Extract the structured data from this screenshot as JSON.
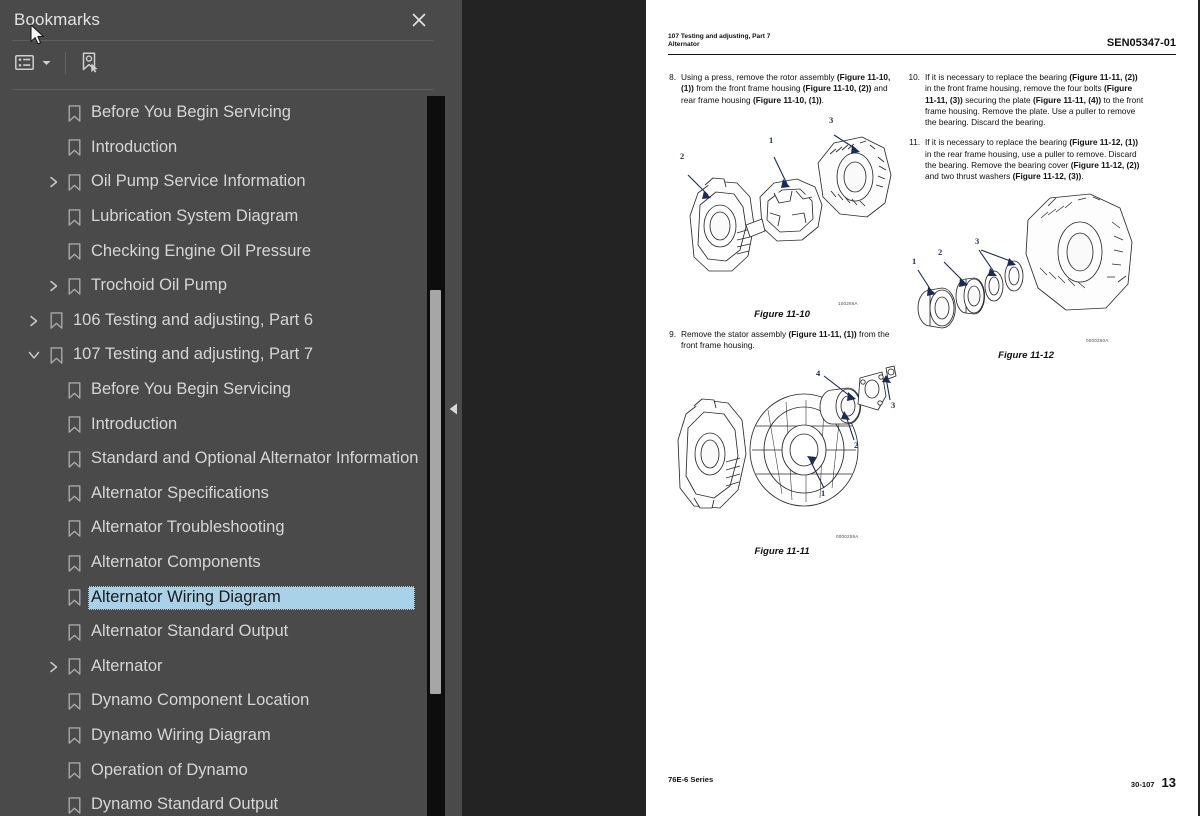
{
  "panel": {
    "title": "Bookmarks",
    "close_icon": "close-icon",
    "toolbar": {
      "options_icon": "list-options-icon",
      "options_caret_icon": "chevron-down-icon",
      "new_bookmark_icon": "new-bookmark-icon"
    }
  },
  "tree": {
    "items": [
      {
        "label": "Before You Begin Servicing",
        "depth": 2,
        "twisty": "",
        "selected": false
      },
      {
        "label": "Introduction",
        "depth": 2,
        "twisty": "",
        "selected": false
      },
      {
        "label": "Oil Pump Service Information",
        "depth": 2,
        "twisty": "collapsed",
        "selected": false
      },
      {
        "label": "Lubrication System Diagram",
        "depth": 2,
        "twisty": "",
        "selected": false
      },
      {
        "label": "Checking Engine Oil Pressure",
        "depth": 2,
        "twisty": "",
        "selected": false
      },
      {
        "label": "Trochoid Oil Pump",
        "depth": 2,
        "twisty": "collapsed",
        "selected": false
      },
      {
        "label": "106 Testing and adjusting, Part 6",
        "depth": 1,
        "twisty": "collapsed",
        "selected": false
      },
      {
        "label": "107 Testing and adjusting, Part 7",
        "depth": 1,
        "twisty": "expanded",
        "selected": false
      },
      {
        "label": "Before You Begin Servicing",
        "depth": 2,
        "twisty": "",
        "selected": false
      },
      {
        "label": "Introduction",
        "depth": 2,
        "twisty": "",
        "selected": false
      },
      {
        "label": "Standard and Optional Alternator Information",
        "depth": 2,
        "twisty": "",
        "selected": false
      },
      {
        "label": "Alternator Specifications",
        "depth": 2,
        "twisty": "",
        "selected": false
      },
      {
        "label": "Alternator Troubleshooting",
        "depth": 2,
        "twisty": "",
        "selected": false
      },
      {
        "label": "Alternator Components",
        "depth": 2,
        "twisty": "",
        "selected": false
      },
      {
        "label": "Alternator Wiring Diagram",
        "depth": 2,
        "twisty": "",
        "selected": true
      },
      {
        "label": "Alternator Standard Output",
        "depth": 2,
        "twisty": "",
        "selected": false
      },
      {
        "label": "Alternator",
        "depth": 2,
        "twisty": "collapsed",
        "selected": false
      },
      {
        "label": "Dynamo Component Location",
        "depth": 2,
        "twisty": "",
        "selected": false
      },
      {
        "label": "Dynamo Wiring Diagram",
        "depth": 2,
        "twisty": "",
        "selected": false
      },
      {
        "label": "Operation of Dynamo",
        "depth": 2,
        "twisty": "",
        "selected": false
      },
      {
        "label": "Dynamo Standard Output",
        "depth": 2,
        "twisty": "",
        "selected": false
      }
    ]
  },
  "splitter": {
    "collapse_icon": "collapse-left-icon"
  },
  "document": {
    "header": {
      "left_line1": "107 Testing and adjusting, Part 7",
      "left_line2": "Alternator",
      "right": "SEN05347-01"
    },
    "left_column": {
      "steps": [
        {
          "num": "8.",
          "runs": [
            {
              "t": "Using a press, remove the rotor assembly ",
              "b": false
            },
            {
              "t": "(Figure 11-10, (1))",
              "b": true
            },
            {
              "t": " from the front frame housing ",
              "b": false
            },
            {
              "t": "(Figure 11-10, (2))",
              "b": true
            },
            {
              "t": " and rear frame housing ",
              "b": false
            },
            {
              "t": "(Figure 11-10, (1))",
              "b": true
            },
            {
              "t": ".",
              "b": false
            }
          ]
        },
        {
          "num": "9.",
          "runs": [
            {
              "t": "Remove the stator assembly ",
              "b": false
            },
            {
              "t": "(Figure 11-11, (1))",
              "b": true
            },
            {
              "t": " from the front frame housing.",
              "b": false
            }
          ]
        }
      ]
    },
    "right_column": {
      "steps": [
        {
          "num": "10.",
          "runs": [
            {
              "t": "If it is necessary to replace the bearing ",
              "b": false
            },
            {
              "t": "(Figure 11-11, (2))",
              "b": true
            },
            {
              "t": " in the front frame housing, remove the four bolts ",
              "b": false
            },
            {
              "t": "(Figure 11-11, (3))",
              "b": true
            },
            {
              "t": " securing the plate ",
              "b": false
            },
            {
              "t": "(Figure 11-11, (4))",
              "b": true
            },
            {
              "t": " to the front frame housing. Remove the plate. Use a puller to remove the bearing. Discard the bearing.",
              "b": false
            }
          ]
        },
        {
          "num": "11.",
          "runs": [
            {
              "t": "If it is necessary to replace the bearing ",
              "b": false
            },
            {
              "t": "(Figure 11-12, (1))",
              "b": true
            },
            {
              "t": " in the rear frame housing, use a puller to remove. Discard the bearing. Remove the bearing cover ",
              "b": false
            },
            {
              "t": "(Figure 11-12, (2))",
              "b": true
            },
            {
              "t": " and two thrust washers ",
              "b": false
            },
            {
              "t": "(Figure 11-12, (3))",
              "b": true
            },
            {
              "t": ".",
              "b": false
            }
          ]
        }
      ]
    },
    "figures": [
      {
        "name": "figure-11-10",
        "caption": "Figure 11-10",
        "code": "100266A",
        "callouts": [
          "1",
          "2",
          "3"
        ]
      },
      {
        "name": "figure-11-11",
        "caption": "Figure 11-11",
        "code": "0000259A",
        "callouts": [
          "1",
          "2",
          "3",
          "4"
        ]
      },
      {
        "name": "figure-11-12",
        "caption": "Figure 11-12",
        "code": "0000260A",
        "callouts": [
          "1",
          "2",
          "3"
        ]
      }
    ],
    "footer": {
      "left": "76E-6 Series",
      "section": "30-107",
      "page": "13"
    }
  },
  "colors": {
    "panel_bg": "#4a4a4a",
    "viewer_bg": "#232323",
    "selection": "#a9d2e9",
    "page_bg": "#ffffff",
    "scrollbar_thumb": "#a6a6a6",
    "callout_blue": "#1b2b55"
  }
}
